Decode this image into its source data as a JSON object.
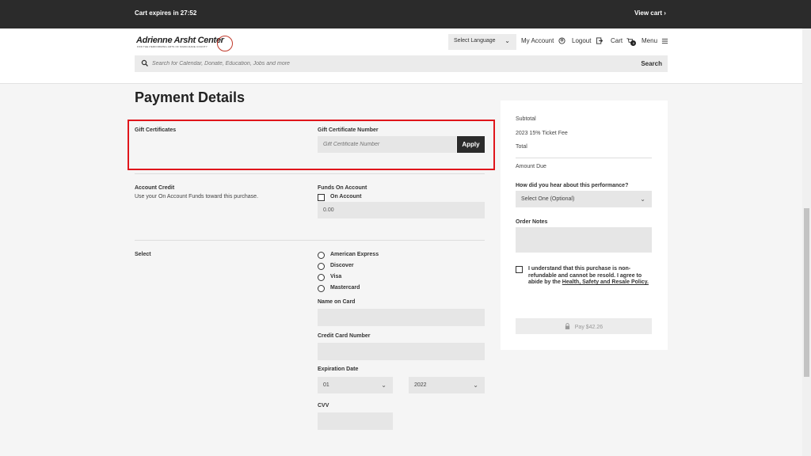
{
  "banner": {
    "expires": "Cart expires in 27:52",
    "view_cart": "View cart ›"
  },
  "header": {
    "logo_name": "Adrienne Arsht Center",
    "logo_tag": "FOR THE PERFORMING ARTS OF MIAMI-DADE COUNTY",
    "language": "Select Language",
    "my_account": "My Account",
    "logout": "Logout",
    "cart": "Cart",
    "cart_count": "0",
    "menu": "Menu"
  },
  "search": {
    "placeholder": "Search for Calendar, Donate, Education, Jobs and more",
    "button": "Search"
  },
  "page": {
    "title": "Payment Details"
  },
  "gift": {
    "section_label": "Gift Certificates",
    "number_label": "Gift Certificate Number",
    "placeholder": "Gift Certificate Number",
    "apply": "Apply"
  },
  "account": {
    "section_label": "Account Credit",
    "description": "Use your On Account Funds toward this purchase.",
    "funds_label": "Funds On Account",
    "checkbox_label": "On Account",
    "amount": "0.00"
  },
  "payment": {
    "section_label": "Select",
    "cards": [
      "American Express",
      "Discover",
      "Visa",
      "Mastercard"
    ],
    "name_label": "Name on Card",
    "number_label": "Credit Card Number",
    "expiration_label": "Expiration Date",
    "exp_month": "01",
    "exp_year": "2022",
    "cvv_label": "CVV"
  },
  "summary": {
    "subtotal": "Subtotal",
    "fee": "2023 15% Ticket Fee",
    "total": "Total",
    "amount_due": "Amount Due",
    "hear_label": "How did you hear about this performance?",
    "hear_value": "Select One (Optional)",
    "notes_label": "Order Notes",
    "policy_text": "I understand that this purchase is non-refundable and cannot be resold. I agree to abide by the",
    "policy_link": "Health, Safety and Resale Policy.",
    "pay": "Pay $42.26"
  }
}
